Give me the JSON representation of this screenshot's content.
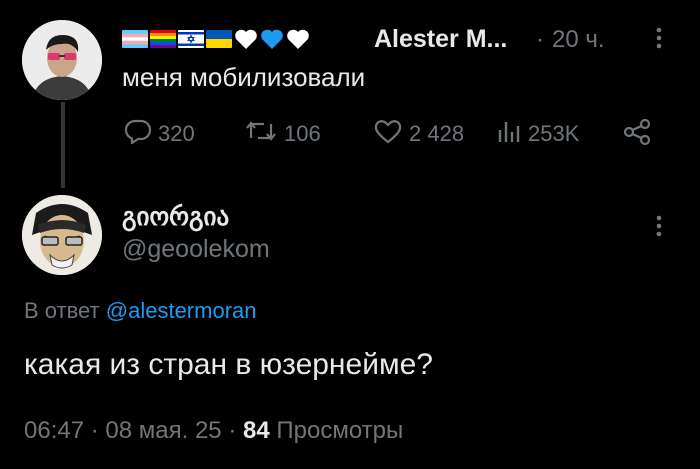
{
  "original_tweet": {
    "flags": [
      "transgender-flag",
      "rainbow-pride-flag",
      "israel-flag",
      "ukraine-flag"
    ],
    "hearts": [
      "#ffffff",
      "#1d9bf0",
      "#ffffff"
    ],
    "author_name": "Alester M...",
    "separator": "·",
    "time": "20 ч.",
    "text": "меня мобилизовали",
    "replies": "320",
    "retweets": "106",
    "likes": "2 428",
    "views": "253K"
  },
  "reply_tweet": {
    "display_name": "გიორგია",
    "handle": "@geoolekom",
    "reply_prefix": "В ответ",
    "reply_to": "@alestermoran",
    "text": "какая из стран в юзернейме?",
    "time": "06:47",
    "date": "08 мая. 25",
    "dot1": "·",
    "dot2": "·",
    "views_count": "84",
    "views_label": "Просмотры"
  },
  "colors": {
    "link": "#1d9bf0",
    "muted": "#71767b",
    "text": "#e7e9ea",
    "background": "#000000"
  }
}
